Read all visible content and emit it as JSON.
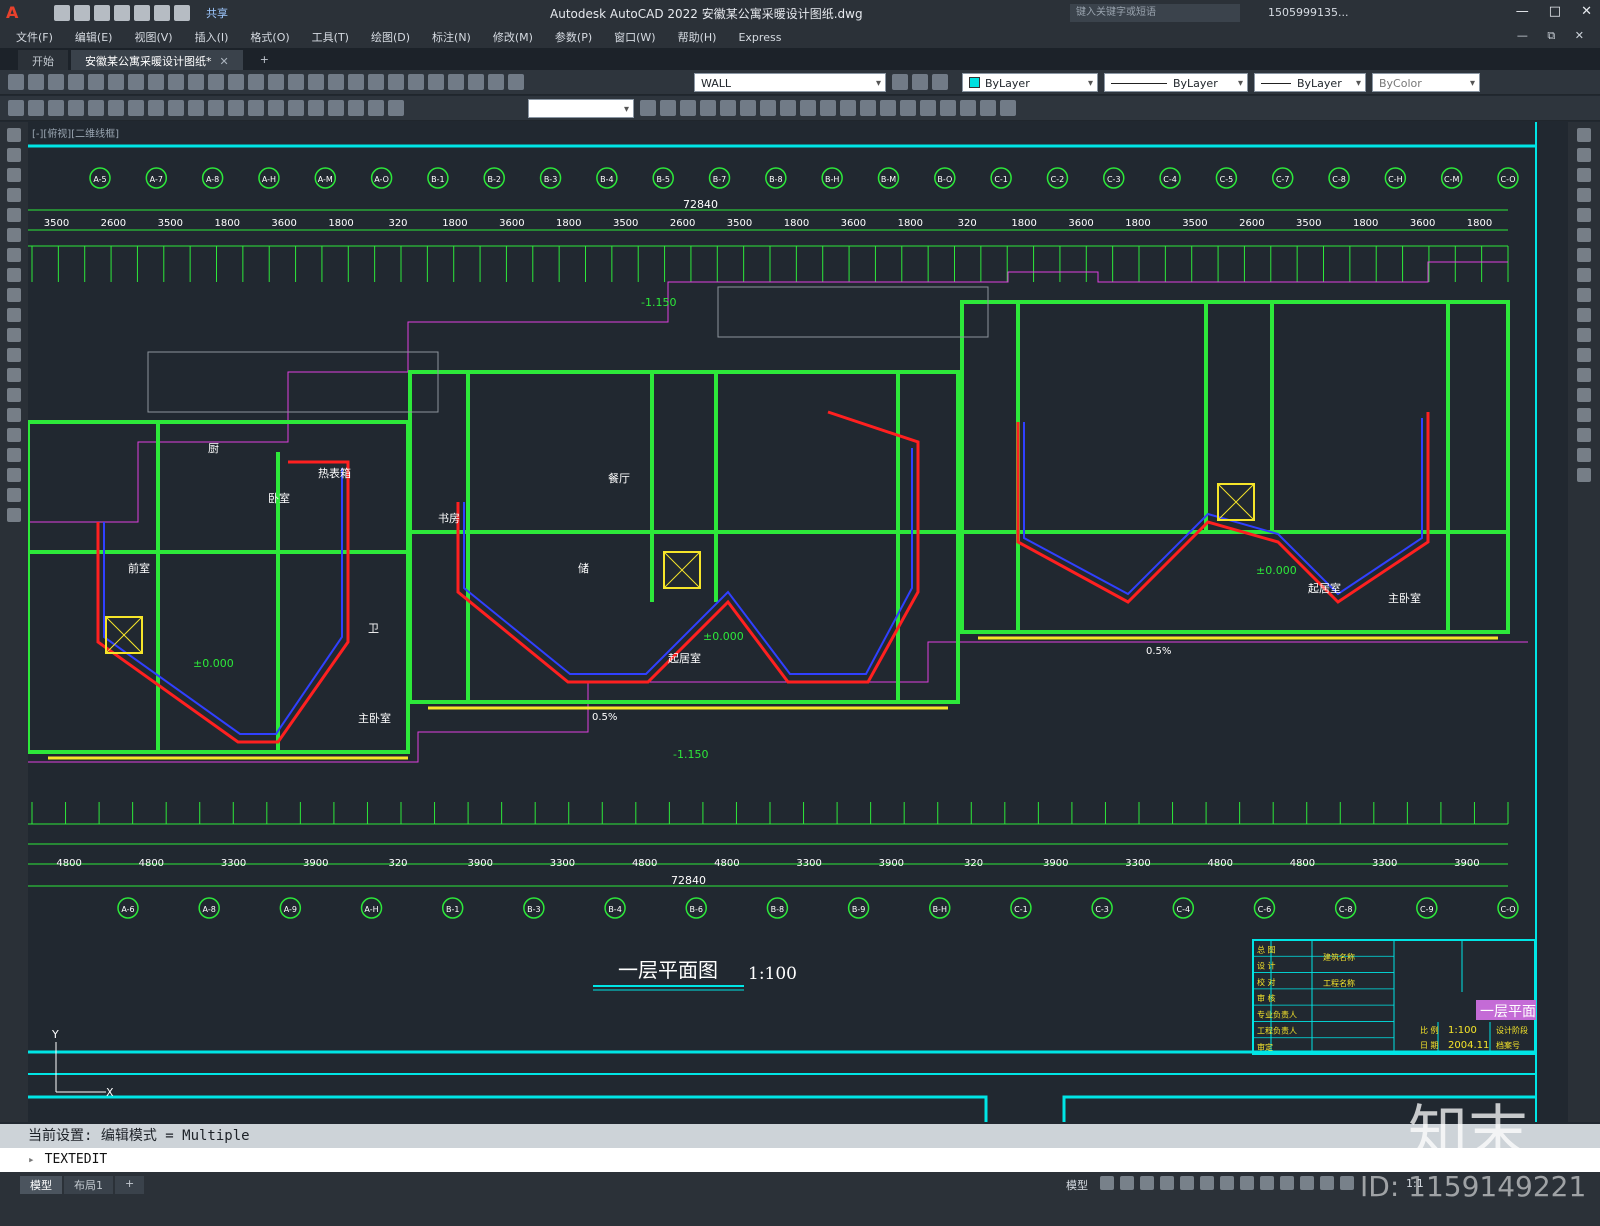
{
  "app": {
    "title": "Autodesk AutoCAD 2022    安徽某公寓采暖设计图纸.dwg",
    "share_label": "共享",
    "search_placeholder": "键入关键字或短语",
    "user": "1505999135...",
    "logo": "A"
  },
  "menu": [
    "文件(F)",
    "编辑(E)",
    "视图(V)",
    "插入(I)",
    "格式(O)",
    "工具(T)",
    "绘图(D)",
    "标注(N)",
    "修改(M)",
    "参数(P)",
    "窗口(W)",
    "帮助(H)",
    "Express"
  ],
  "tabs": [
    {
      "label": "开始"
    },
    {
      "label": "安徽某公寓采暖设计图纸*"
    }
  ],
  "layer": {
    "current": "WALL",
    "color": "ByLayer",
    "linetype": "ByLayer",
    "lineweight": "ByLayer",
    "plotstyle": "ByColor"
  },
  "viewport_label": "[-][俯视][二维线框]",
  "drawing": {
    "overall_dim": "72840",
    "title": "一层平面图",
    "scale": "1:100",
    "top_axes": [
      "A-5",
      "A-7",
      "A-8",
      "A-H",
      "A-M",
      "A-O",
      "B-1",
      "B-2",
      "B-3",
      "B-4",
      "B-5",
      "B-7",
      "B-8",
      "B-H",
      "B-M",
      "B-O",
      "C-1",
      "C-2",
      "C-3",
      "C-4",
      "C-5",
      "C-7",
      "C-8",
      "C-H",
      "C-M",
      "C-O"
    ],
    "bottom_axes": [
      "A-6",
      "A-8",
      "A-9",
      "A-H",
      "B-1",
      "B-3",
      "B-4",
      "B-6",
      "B-8",
      "B-9",
      "B-H",
      "C-1",
      "C-3",
      "C-4",
      "C-6",
      "C-8",
      "C-9",
      "C-O"
    ],
    "top_dims": [
      "3500",
      "2600",
      "3500",
      "1800",
      "3600",
      "1800",
      "320",
      "1800",
      "3600",
      "1800",
      "3500",
      "2600",
      "3500",
      "1800",
      "3600",
      "1800",
      "320",
      "1800",
      "3600",
      "1800",
      "3500",
      "2600",
      "3500",
      "1800",
      "3600",
      "1800"
    ],
    "bottom_dims": [
      "4800",
      "4800",
      "3300",
      "3900",
      "320",
      "3900",
      "3300",
      "4800",
      "4800",
      "3300",
      "3900",
      "320",
      "3900",
      "3300",
      "4800",
      "4800",
      "3300",
      "3900"
    ],
    "rooms": [
      "卧室",
      "书房",
      "餐厅",
      "起居室",
      "主卧室",
      "前室",
      "卫",
      "储",
      "热表箱",
      "厨",
      "主卧室",
      "起居室"
    ],
    "levels": [
      "±0.000",
      "-1.150",
      "0.5%"
    ],
    "titleblock": {
      "rows": [
        "总 图",
        "设 计",
        "校 对",
        "审 核",
        "专业负责人",
        "工程负责人",
        "审定"
      ],
      "project": "建筑名称",
      "sheet": "一层平面",
      "scale_label": "比 例",
      "scale_val": "1:100",
      "date_label": "日 期",
      "date_val": "2004.11",
      "extra1": "设计阶段",
      "extra2": "档案号",
      "extra3": "工程名称"
    }
  },
  "command": {
    "history": "当前设置: 编辑模式 = Multiple",
    "current": "TEXTEDIT"
  },
  "status": {
    "layouts": [
      "模型",
      "布局1"
    ],
    "model": "模型",
    "scale": "1:1"
  },
  "watermark": {
    "brand": "知末",
    "id": "ID: 1159149221"
  },
  "colors": {
    "bg": "#212830",
    "green": "#2de83a",
    "red": "#ff2020",
    "blue": "#3040ff",
    "yellow": "#f6e52a",
    "magenta": "#e040e0",
    "cyan": "#00e0e0"
  }
}
